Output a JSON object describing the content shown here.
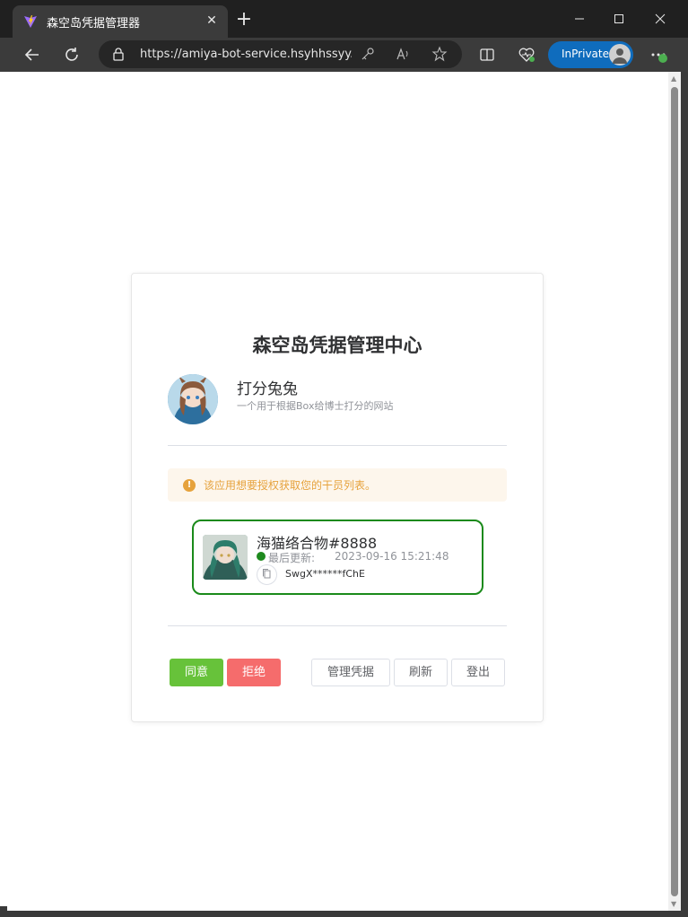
{
  "browser": {
    "tab_title": "森空岛凭据管理器",
    "url": "https://amiya-bot-service.hsyhhssyy...",
    "inprivate_label": "InPrivate"
  },
  "card": {
    "title": "森空岛凭据管理中心",
    "app": {
      "name": "打分兔兔",
      "description": "一个用于根据Box给博士打分的网站"
    },
    "alert_text": "该应用想要授权获取您的干员列表。",
    "account": {
      "name": "海猫络合物#8888",
      "update_label": "最后更新:",
      "update_time": "2023-09-16 15:21:48",
      "token": "SwgX******fChE",
      "selected_border_color": "#1a8a1a",
      "status_color": "#1e8a1e"
    },
    "buttons": {
      "agree": "同意",
      "reject": "拒绝",
      "manage": "管理凭据",
      "refresh": "刷新",
      "logout": "登出"
    }
  },
  "colors": {
    "agree": "#67c23a",
    "reject": "#f56c6c",
    "warning": "#e6a23c",
    "inprivate": "#0f6cbd"
  }
}
